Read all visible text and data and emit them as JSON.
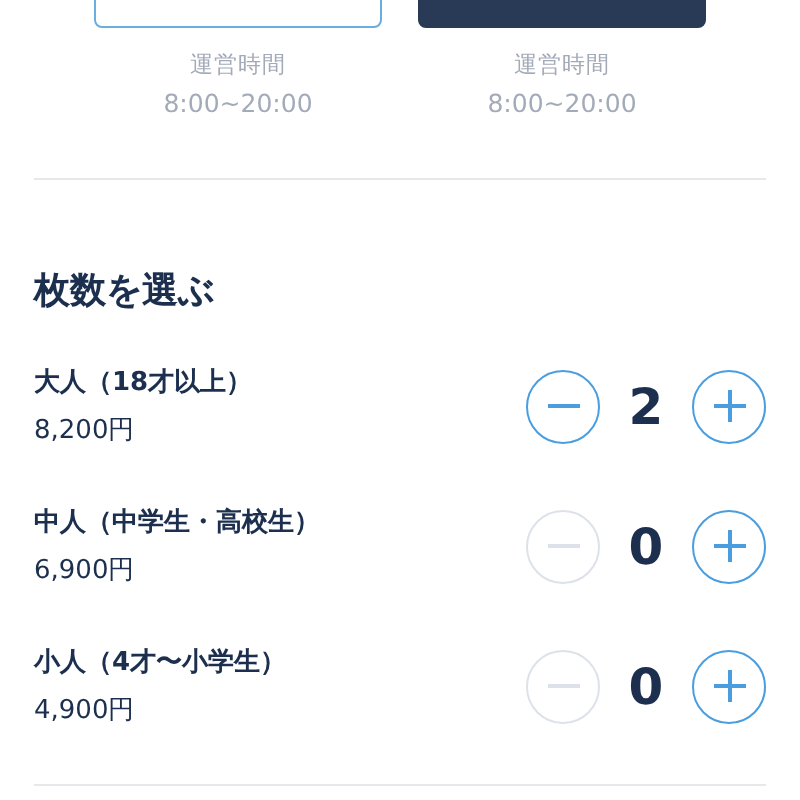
{
  "options": [
    {
      "selected": false,
      "hours_label": "運営時間",
      "hours": "8:00~20:00"
    },
    {
      "selected": true,
      "hours_label": "運営時間",
      "hours": "8:00~20:00"
    }
  ],
  "heading": "枚数を選ぶ",
  "tickets": [
    {
      "label": "大人（18才以上）",
      "price": "8,200円",
      "count": "2",
      "minus_disabled": false
    },
    {
      "label": "中人（中学生・高校生）",
      "price": "6,900円",
      "count": "0",
      "minus_disabled": true
    },
    {
      "label": "小人（4才〜小学生）",
      "price": "4,900円",
      "count": "0",
      "minus_disabled": true
    }
  ]
}
